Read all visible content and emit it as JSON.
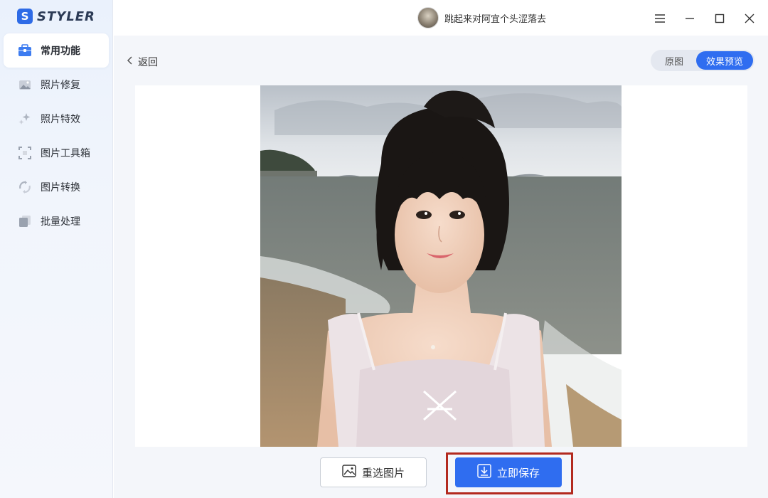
{
  "app": {
    "logo_letter": "S",
    "logo_text": "STYLER"
  },
  "sidebar": {
    "items": [
      {
        "label": "常用功能",
        "icon": "toolbox-icon",
        "active": true
      },
      {
        "label": "照片修复",
        "icon": "photo-repair-icon",
        "active": false
      },
      {
        "label": "照片特效",
        "icon": "sparkle-effects-icon",
        "active": false
      },
      {
        "label": "图片工具箱",
        "icon": "crop-frame-icon",
        "active": false
      },
      {
        "label": "图片转换",
        "icon": "convert-cycle-icon",
        "active": false
      },
      {
        "label": "批量处理",
        "icon": "batch-stack-icon",
        "active": false
      }
    ]
  },
  "titlebar": {
    "username": "跳起来对阿宜个头涩落去",
    "controls": [
      "menu-icon",
      "minimize-icon",
      "maximize-icon",
      "close-icon"
    ]
  },
  "content": {
    "back_label": "返回",
    "toggle": {
      "original_label": "原图",
      "preview_label": "效果预览",
      "selected": "效果预览"
    },
    "reselect_label": "重选图片",
    "save_label": "立即保存"
  },
  "colors": {
    "accent": "#2f6df0",
    "highlight_border": "#b32a1f",
    "sidebar_bg": "#eef3fc",
    "content_bg": "#f4f6fa"
  }
}
